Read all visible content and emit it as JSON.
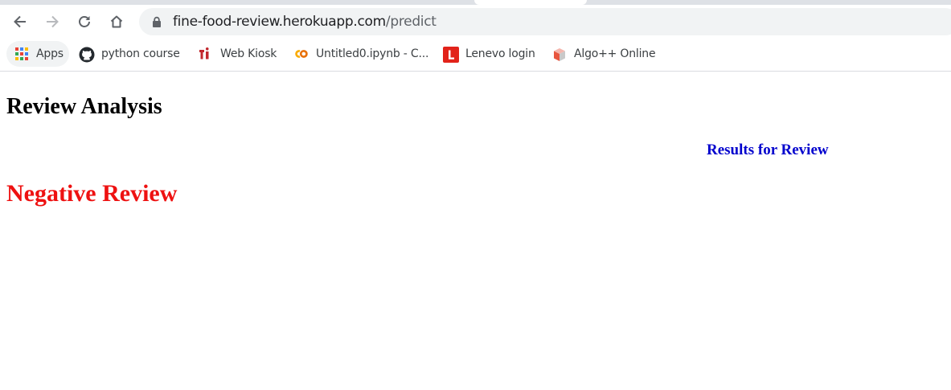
{
  "browser": {
    "url_host": "fine-food-review.herokuapp.com",
    "url_path": "/predict",
    "bookmarks": [
      {
        "label": "Apps",
        "icon": "apps-grid-icon"
      },
      {
        "label": "python course",
        "icon": "github-icon"
      },
      {
        "label": "Web Kiosk",
        "icon": "ti-logo-icon"
      },
      {
        "label": "Untitled0.ipynb - C...",
        "icon": "colab-icon"
      },
      {
        "label": "Lenevo login",
        "icon": "l-logo-icon"
      },
      {
        "label": "Algo++ Online",
        "icon": "cube-icon"
      }
    ]
  },
  "page": {
    "title": "Review Analysis",
    "results_heading": "Results for Review",
    "prediction": "Negative Review",
    "prediction_color": "#ee1111",
    "results_color": "#0000cd"
  }
}
